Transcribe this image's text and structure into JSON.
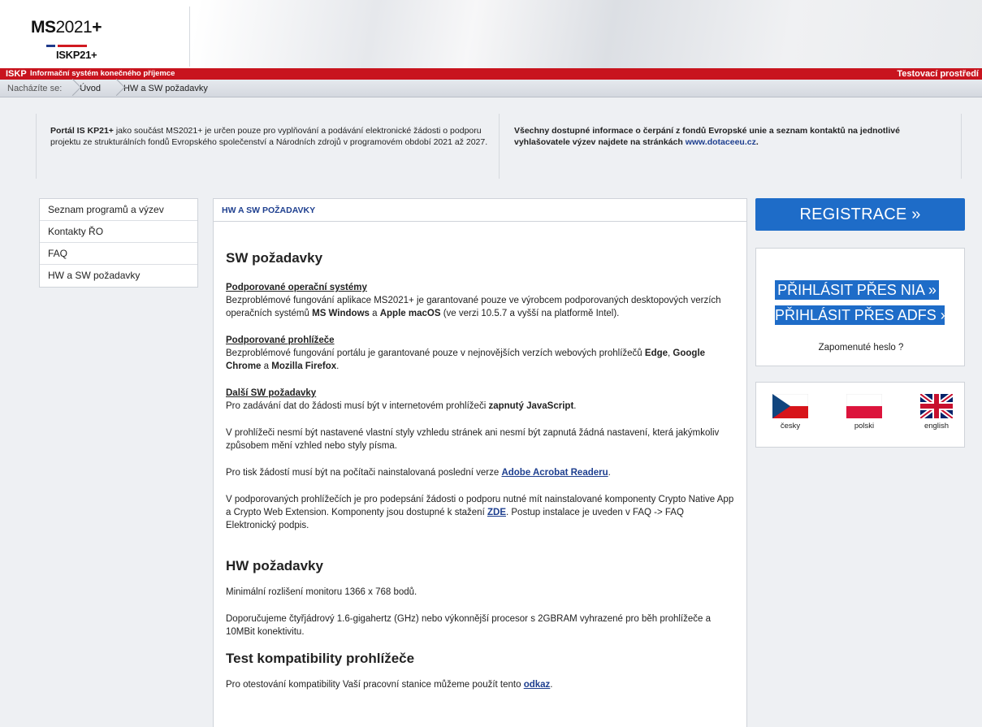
{
  "header": {
    "logo_ms_bold": "MS",
    "logo_ms_rest": "2021",
    "logo_plus": "+",
    "logo_iskp": "ISKP21+",
    "bar_iskp": "ISKP",
    "bar_system": "Informační systém konečného příjemce",
    "bar_environment": "Testovací prostředí",
    "colors": {
      "red": "#c8141e",
      "blue": "#1e6cc8",
      "navy": "#1f3a8a"
    }
  },
  "breadcrumb": {
    "label": "Nacházíte se:",
    "items": [
      "Úvod",
      "HW a SW požadavky"
    ]
  },
  "info": {
    "left_bold": "Portál IS KP21+",
    "left_text": " jako součást MS2021+ je určen pouze pro vyplňování a podávání elektronické žádosti o podporu projektu ze strukturálních fondů Evropského společenství a Národních zdrojů v programovém období 2021 až 2027.",
    "right_text": "Všechny dostupné informace o čerpání z fondů Evropské unie a seznam kontaktů na jednotlivé vyhlašovatele výzev najdete na stránkách ",
    "right_link": "www.dotaceeu.cz",
    "right_end": "."
  },
  "menu": {
    "items": [
      {
        "label": "Seznam programů a výzev"
      },
      {
        "label": "Kontakty ŘO"
      },
      {
        "label": "FAQ"
      },
      {
        "label": "HW a SW požadavky"
      }
    ]
  },
  "main": {
    "header": "HW A SW POŽADAVKY",
    "sw_title": "SW požadavky",
    "os_title": "Podporované operační systémy",
    "os_text_1": "Bezproblémové fungování aplikace MS2021+ je garantované pouze ve výrobcem podporovaných desktopových verzích operačních systémů ",
    "os_bold_1": "MS Windows",
    "os_text_2": " a ",
    "os_bold_2": "Apple macOS",
    "os_text_3": " (ve verzi 10.5.7 a vyšší na platformě Intel).",
    "br_title": "Podporované prohlížeče",
    "br_text_1": "Bezproblémové fungování portálu je garantované pouze v nejnovějších verzích webových prohlížečů ",
    "br_bold_1": "Edge",
    "br_text_2": ", ",
    "br_bold_2": "Google Chrome",
    "br_text_3": " a ",
    "br_bold_3": "Mozilla Firefox",
    "br_text_4": ".",
    "other_title": "Další SW požadavky",
    "other_text_1": "Pro zadávání dat do žádosti musí být v internetovém prohlížeči ",
    "other_bold": "zapnutý JavaScript",
    "other_text_2": ".",
    "styles_text": "V prohlížeči nesmí být nastavené vlastní styly vzhledu stránek ani nesmí být zapnutá žádná nastavení, která jakýmkoliv způsobem mění vzhled nebo styly písma.",
    "print_text": "Pro tisk žádostí musí být na počítači nainstalovaná poslední verze ",
    "print_link": "Adobe Acrobat Readeru",
    "print_end": ".",
    "crypto_text_1": "V podporovaných prohlížečích je pro podepsání žádosti o podporu nutné mít nainstalované komponenty Crypto Native App a Crypto Web Extension. Komponenty jsou dostupné k stažení ",
    "crypto_link": "ZDE",
    "crypto_text_2": ". Postup instalace je uveden v FAQ -> FAQ Elektronický podpis.",
    "hw_title": "HW požadavky",
    "hw_text_1": "Minimální rozlišení monitoru 1366 x 768 bodů.",
    "hw_text_2": "Doporučujeme čtyřjádrový 1.6-gigahertz (GHz) nebo výkonnější procesor s 2GBRAM vyhrazené pro běh prohlížeče a 10MBit konektivitu.",
    "test_title": "Test kompatibility prohlížeče",
    "test_text": "Pro otestování kompatibility Vaší pracovní stanice můžeme použít tento ",
    "test_link": "odkaz",
    "test_end": "."
  },
  "right": {
    "register": "REGISTRACE »",
    "login_nia": "PŘIHLÁSIT PŘES NIA »",
    "login_adfs": "PŘIHLÁSIT PŘES ADFS »",
    "forgot": "Zapomenuté heslo ?",
    "languages": [
      {
        "label": "česky",
        "icon": "czech-flag-icon"
      },
      {
        "label": "polski",
        "icon": "polish-flag-icon"
      },
      {
        "label": "english",
        "icon": "uk-flag-icon"
      }
    ]
  }
}
